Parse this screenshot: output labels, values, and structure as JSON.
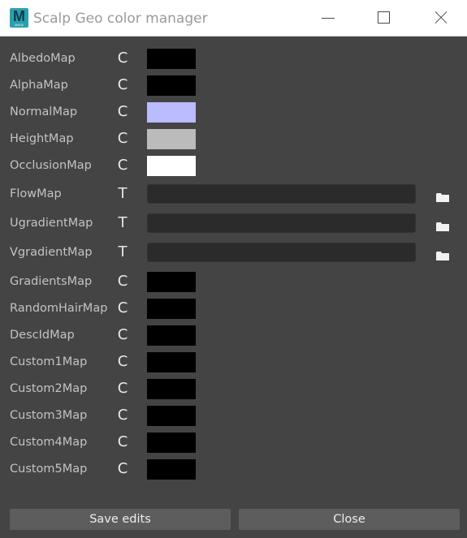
{
  "window": {
    "title": "Scalp Geo color manager",
    "app_icon_letter": "M",
    "app_icon_caption": "MAYA"
  },
  "maps": [
    {
      "name": "AlbedoMap",
      "type": "C",
      "color": "#000000"
    },
    {
      "name": "AlphaMap",
      "type": "C",
      "color": "#000000"
    },
    {
      "name": "NormalMap",
      "type": "C",
      "color": "#bbbbff"
    },
    {
      "name": "HeightMap",
      "type": "C",
      "color": "#bbbbbb"
    },
    {
      "name": "OcclusionMap",
      "type": "C",
      "color": "#ffffff"
    },
    {
      "name": "FlowMap",
      "type": "T",
      "value": ""
    },
    {
      "name": "UgradientMap",
      "type": "T",
      "value": ""
    },
    {
      "name": "VgradientMap",
      "type": "T",
      "value": ""
    },
    {
      "name": "GradientsMap",
      "type": "C",
      "color": "#000000"
    },
    {
      "name": "RandomHairMap",
      "type": "C",
      "color": "#000000"
    },
    {
      "name": "DescIdMap",
      "type": "C",
      "color": "#000000"
    },
    {
      "name": "Custom1Map",
      "type": "C",
      "color": "#000000"
    },
    {
      "name": "Custom2Map",
      "type": "C",
      "color": "#000000"
    },
    {
      "name": "Custom3Map",
      "type": "C",
      "color": "#000000"
    },
    {
      "name": "Custom4Map",
      "type": "C",
      "color": "#000000"
    },
    {
      "name": "Custom5Map",
      "type": "C",
      "color": "#000000"
    }
  ],
  "buttons": {
    "save": "Save edits",
    "close": "Close"
  },
  "icons": {
    "browse": "folder-icon",
    "minimize": "minimize-icon",
    "maximize": "maximize-icon",
    "close": "close-icon"
  }
}
